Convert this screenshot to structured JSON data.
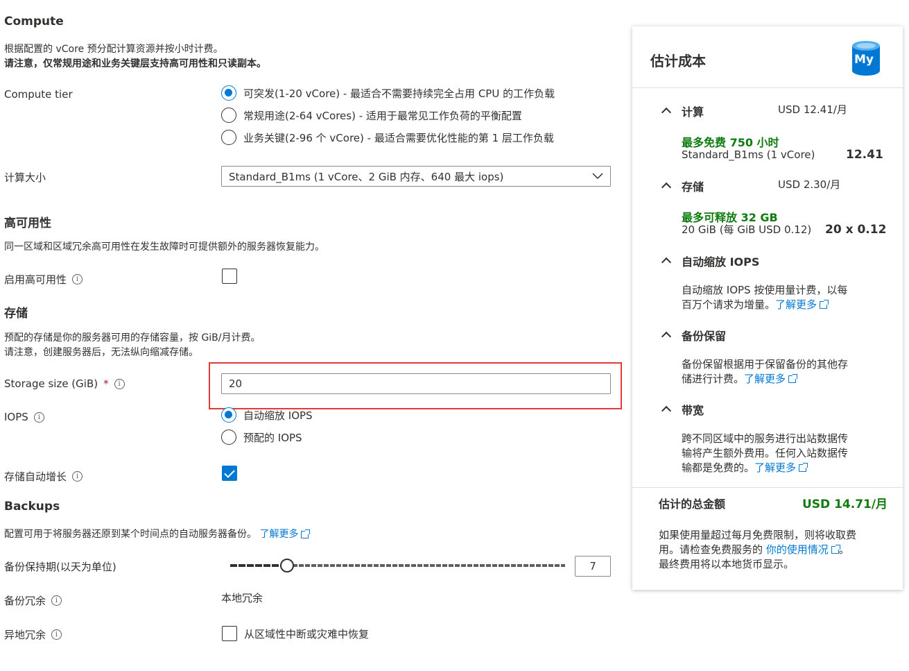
{
  "compute": {
    "heading": "Compute",
    "desc1": "根据配置的 vCore 预分配计算资源并按小时计费。",
    "desc2": "请注意，仅常规用途和业务关键层支持高可用性和只读副本。",
    "tier_label": "Compute tier",
    "tiers": [
      {
        "label": "可突发(1-20 vCore) - 最适合不需要持续完全占用 CPU 的工作负载",
        "checked": true
      },
      {
        "label": "常规用途(2-64 vCores) - 适用于最常见工作负荷的平衡配置",
        "checked": false
      },
      {
        "label": "业务关键(2-96 个 vCore) - 最适合需要优化性能的第 1 层工作负载",
        "checked": false
      }
    ],
    "size_label": "计算大小",
    "size_value": "Standard_B1ms (1 vCore、2 GiB 内存、640 最大 iops)"
  },
  "ha": {
    "heading": "高可用性",
    "desc": "同一区域和区域冗余高可用性在发生故障时可提供额外的服务器恢复能力。",
    "enable_label": "启用高可用性",
    "enabled": false
  },
  "storage": {
    "heading": "存储",
    "desc1": "预配的存储是你的服务器可用的存储容量，按 GiB/月计费。",
    "desc2": "请注意，创建服务器后，无法纵向缩减存储。",
    "size_label": "Storage size (GiB)",
    "required_mark": "*",
    "size_value": "20",
    "iops_label": "IOPS",
    "iops_options": [
      {
        "label": "自动缩放 IOPS",
        "checked": true
      },
      {
        "label": "预配的 IOPS",
        "checked": false
      }
    ],
    "autogrow_label": "存储自动增长",
    "autogrow": true
  },
  "backups": {
    "heading": "Backups",
    "desc": "配置可用于将服务器还原到某个时间点的自动服务器备份。",
    "learn_more": "了解更多",
    "retention_label": "备份保持期(以天为单位)",
    "retention_value": "7",
    "retention_fraction": 0.17,
    "redundancy_label": "备份冗余",
    "redundancy_value": "本地冗余",
    "geo_label": "异地冗余",
    "geo_option": "从区域性中断或灾难中恢复",
    "geo_checked": false
  },
  "cost": {
    "title": "估计成本",
    "logo_text": "My",
    "compute": {
      "title": "计算",
      "amount": "USD 12.41/月",
      "free": "最多免费 750 小时",
      "sku": "Standard_B1ms (1 vCore)",
      "value": "12.41"
    },
    "storage": {
      "title": "存储",
      "amount": "USD 2.30/月",
      "free": "最多可释放 32 GB",
      "detail": "20 GiB (每 GiB USD 0.12)",
      "value": "20 x 0.12"
    },
    "iops": {
      "title": "自动缩放 IOPS",
      "desc1": "自动缩放 IOPS 按使用量计费，以每",
      "desc2": "百万个请求为增量。",
      "learn_more": "了解更多"
    },
    "backup": {
      "title": "备份保留",
      "desc1": "备份保留根据用于保留备份的其他存",
      "desc2": "储进行计费。",
      "learn_more": "了解更多"
    },
    "bandwidth": {
      "title": "带宽",
      "desc1": "跨不同区域中的服务进行出站数据传",
      "desc2": "输将产生额外费用。任何入站数据传",
      "desc3": "输都是免费的。",
      "learn_more": "了解更多"
    },
    "total_label": "估计的总金额",
    "total_value": "USD 14.71/月",
    "note1": "如果使用量超过每月免费限制，则将收取费",
    "note2": "用。请检查免费服务的",
    "note_link": "你的使用情况",
    "note2_end": "。",
    "note3": "最终费用将以本地货币显示。"
  }
}
